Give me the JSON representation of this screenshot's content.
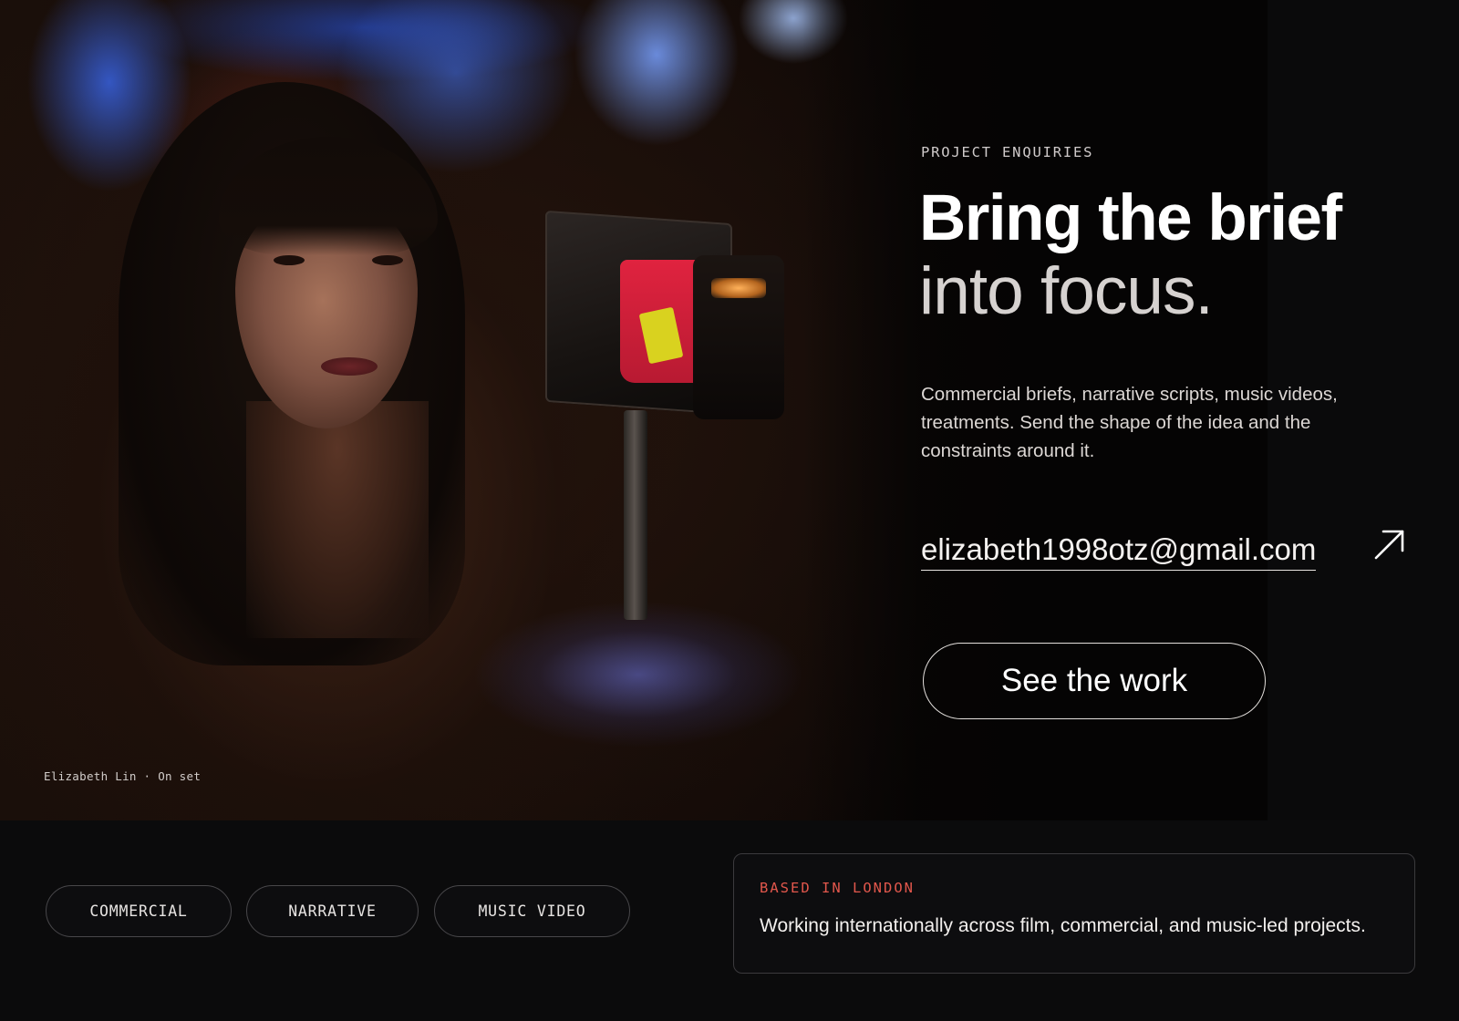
{
  "hero": {
    "caption": "Elizabeth Lin · On set"
  },
  "enquiry": {
    "eyebrow": "PROJECT ENQUIRIES",
    "headline_bold": "Bring the brief",
    "headline_light": "into focus.",
    "body": "Commercial briefs, narrative scripts, music videos, treatments. Send the shape of the idea and the constraints around it.",
    "email": "elizabeth1998otz@gmail.com",
    "email_icon": "arrow-up-right-icon",
    "cta_label": "See the work"
  },
  "tags": [
    {
      "label": "COMMERCIAL"
    },
    {
      "label": "NARRATIVE"
    },
    {
      "label": "MUSIC VIDEO"
    }
  ],
  "info": {
    "label": "BASED IN LONDON",
    "text": "Working internationally across film, commercial, and music-led projects."
  },
  "colors": {
    "background": "#0b0b0c",
    "accent": "#e2574c",
    "text": "#f2f2f2"
  }
}
